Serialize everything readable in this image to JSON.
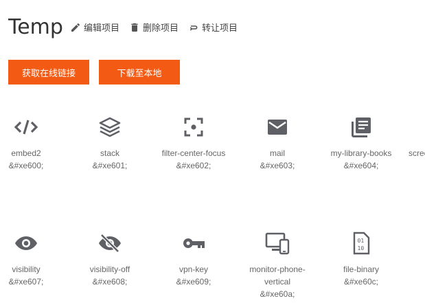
{
  "project": {
    "title": "Temp"
  },
  "actions": {
    "edit": "编辑项目",
    "delete": "删除项目",
    "transfer": "转让项目"
  },
  "buttons": {
    "online_link": "获取在线链接",
    "download": "下载至本地"
  },
  "icons": [
    {
      "name": "embed2",
      "code": "&#xe600;",
      "icon": "embed-icon"
    },
    {
      "name": "stack",
      "code": "&#xe601;",
      "icon": "stack-icon"
    },
    {
      "name": "filter-center-focus",
      "code": "&#xe602;",
      "icon": "filter-center-focus-icon"
    },
    {
      "name": "mail",
      "code": "&#xe603;",
      "icon": "mail-icon"
    },
    {
      "name": "my-library-books",
      "code": "&#xe604;",
      "icon": "library-books-icon"
    },
    {
      "name": "scree",
      "code": "",
      "icon": ""
    },
    {
      "name": "visibility",
      "code": "&#xe607;",
      "icon": "visibility-icon"
    },
    {
      "name": "visibility-off",
      "code": "&#xe608;",
      "icon": "visibility-off-icon"
    },
    {
      "name": "vpn-key",
      "code": "&#xe609;",
      "icon": "vpn-key-icon"
    },
    {
      "name": "monitor-phone-vertical",
      "name2": "vertical",
      "code": "&#xe60a;",
      "icon": "monitor-phone-icon"
    },
    {
      "name": "file-binary",
      "code": "&#xe60c;",
      "icon": "file-binary-icon"
    }
  ]
}
